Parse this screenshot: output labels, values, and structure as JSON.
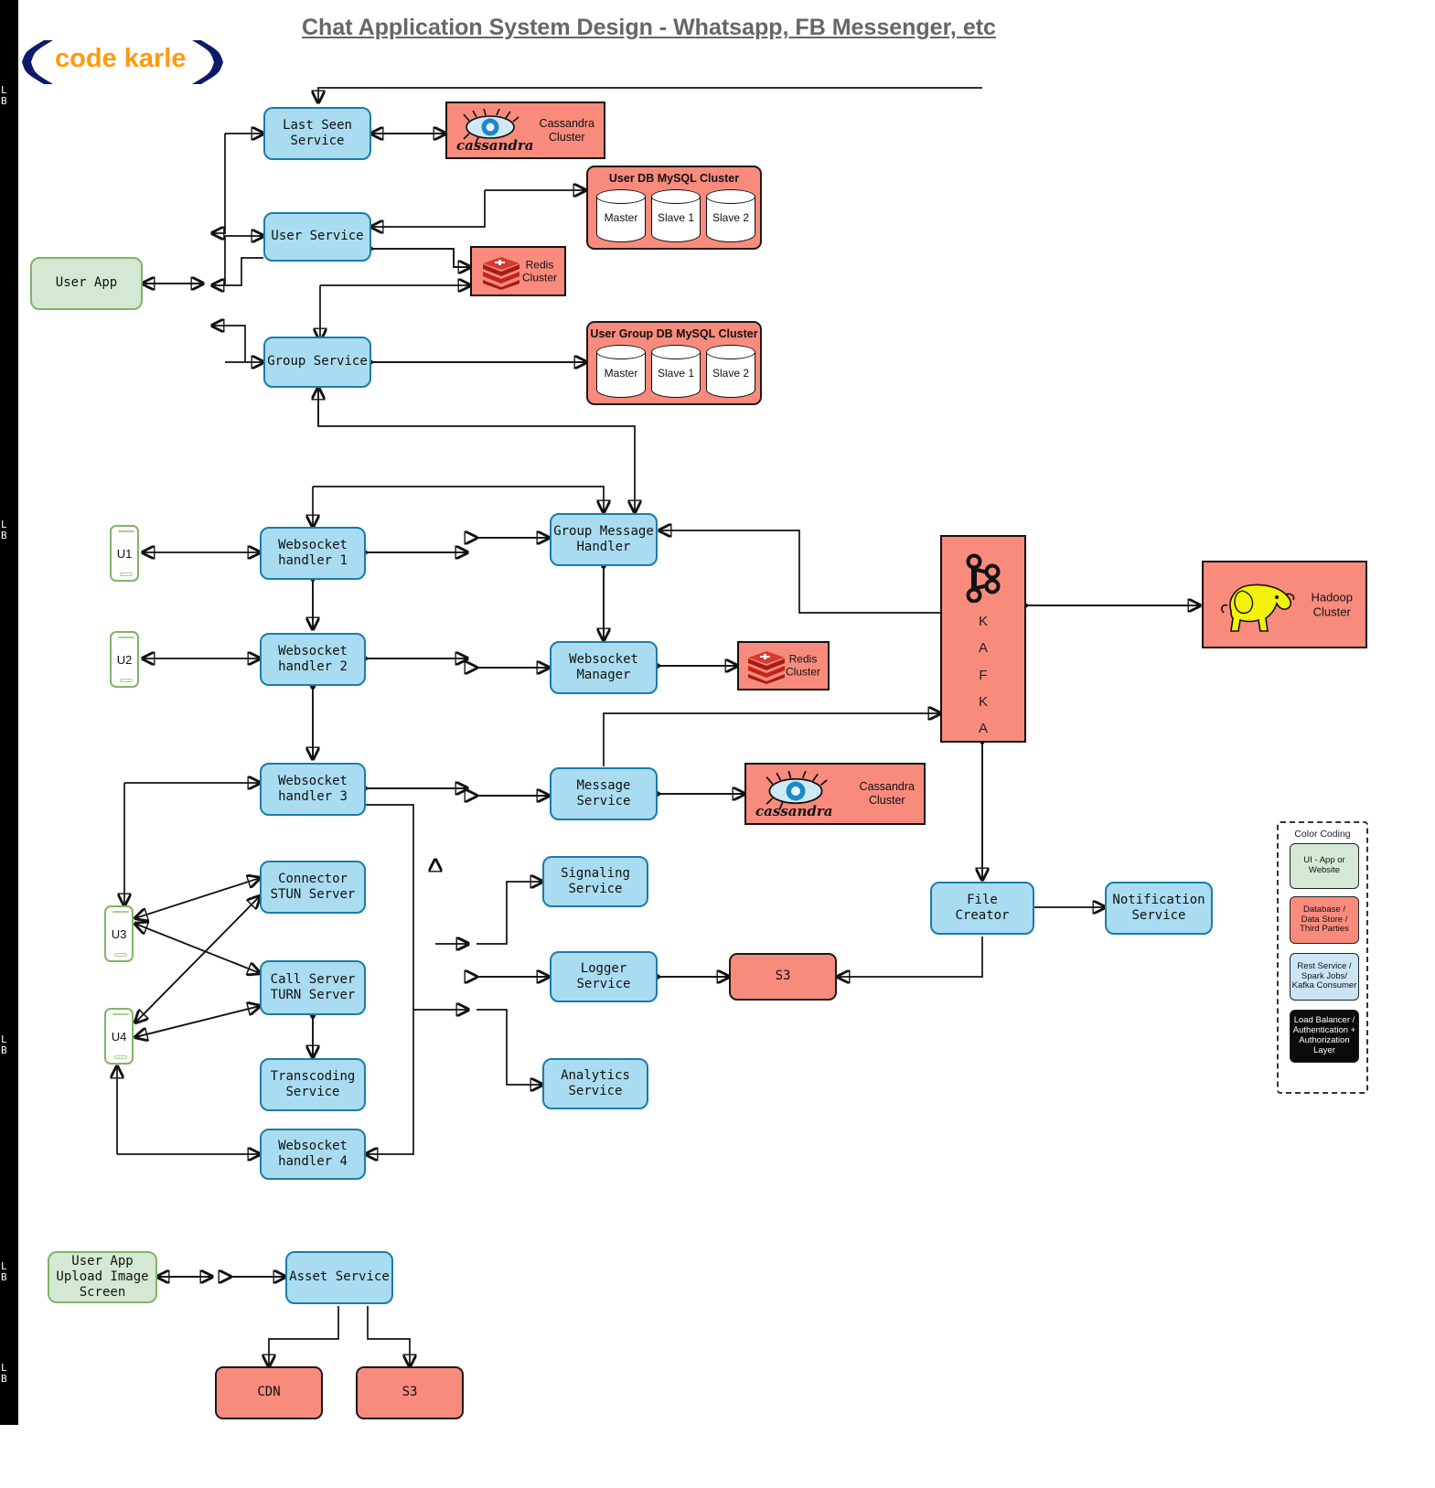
{
  "header": {
    "title": "Chat Application System Design - Whatsapp, FB Messenger, etc",
    "logo_text": "code karle"
  },
  "load_balancers": {
    "label": "L\nB"
  },
  "ui_nodes": [
    {
      "id": "user-app",
      "label": "User App"
    },
    {
      "id": "user-app-upload",
      "label": "User App\nUpload Image\nScreen"
    }
  ],
  "phones": [
    {
      "id": "u1",
      "label": "U1"
    },
    {
      "id": "u2",
      "label": "U2"
    },
    {
      "id": "u3",
      "label": "U3"
    },
    {
      "id": "u4",
      "label": "U4"
    }
  ],
  "services": [
    {
      "id": "last-seen-service",
      "label": "Last Seen\nService"
    },
    {
      "id": "user-service",
      "label": "User Service"
    },
    {
      "id": "group-service",
      "label": "Group Service"
    },
    {
      "id": "websocket-handler-1",
      "label": "Websocket\nhandler 1"
    },
    {
      "id": "websocket-handler-2",
      "label": "Websocket\nhandler 2"
    },
    {
      "id": "websocket-handler-3",
      "label": "Websocket\nhandler 3"
    },
    {
      "id": "websocket-handler-4",
      "label": "Websocket\nhandler 4"
    },
    {
      "id": "group-message-handler",
      "label": "Group Message\nHandler"
    },
    {
      "id": "websocket-manager",
      "label": "Websocket\nManager"
    },
    {
      "id": "message-service",
      "label": "Message\nService"
    },
    {
      "id": "connector-stun-server",
      "label": "Connector\nSTUN Server"
    },
    {
      "id": "call-server-turn-server",
      "label": "Call Server\nTURN Server"
    },
    {
      "id": "transcoding-service",
      "label": "Transcoding\nService"
    },
    {
      "id": "signaling-service",
      "label": "Signaling\nService"
    },
    {
      "id": "logger-service",
      "label": "Logger\nService"
    },
    {
      "id": "analytics-service",
      "label": "Analytics\nService"
    },
    {
      "id": "file-creator",
      "label": "File\nCreator"
    },
    {
      "id": "notification-service",
      "label": "Notification\nService"
    },
    {
      "id": "asset-service",
      "label": "Asset Service"
    }
  ],
  "datastores": [
    {
      "id": "cassandra-cluster-top",
      "label": "Cassandra\nCluster",
      "wordmark": "cassandra"
    },
    {
      "id": "cassandra-cluster-msg",
      "label": "Cassandra\nCluster",
      "wordmark": "cassandra"
    },
    {
      "id": "redis-cluster-user",
      "label": "Redis\nCluster"
    },
    {
      "id": "redis-cluster-ws",
      "label": "Redis\nCluster"
    },
    {
      "id": "s3-logger",
      "label": "S3"
    },
    {
      "id": "s3-asset",
      "label": "S3"
    },
    {
      "id": "cdn-asset",
      "label": "CDN"
    },
    {
      "id": "hadoop-cluster",
      "label": "Hadoop\nCluster"
    },
    {
      "id": "kafka",
      "label": "K\nA\nF\nK\nA"
    }
  ],
  "mysql_clusters": [
    {
      "id": "user-db-mysql-cluster",
      "title": "User DB MySQL Cluster",
      "nodes": [
        "Master",
        "Slave 1",
        "Slave 2"
      ]
    },
    {
      "id": "user-group-db-mysql-cluster",
      "title": "User Group DB MySQL Cluster",
      "nodes": [
        "Master",
        "Slave 1",
        "Slave 2"
      ]
    }
  ],
  "legend": {
    "title": "Color Coding",
    "items": [
      {
        "id": "legend-ui",
        "label": "UI - App or\nWebsite",
        "color": "#D5E8D4"
      },
      {
        "id": "legend-db",
        "label": "Database /\nData Store /\nThird Parties",
        "color": "#F98B7D"
      },
      {
        "id": "legend-svc",
        "label": "Rest Service /\nSpark Jobs/\nKafka Consumer",
        "color": "#CCE5F6"
      },
      {
        "id": "legend-lb",
        "label": "Load Balancer /\nAuthentication +\nAuthorization\nLayer",
        "color": "#0b0b0b"
      }
    ]
  },
  "colors": {
    "service_fill": "#A9DCF0",
    "service_stroke": "#1B7CA8",
    "datastore_fill": "#F98B7D",
    "ui_fill": "#D5E8D4",
    "ui_stroke": "#82B366",
    "lb_fill": "#000000",
    "title_color": "#666666",
    "logo_word_color": "#FF9A0E",
    "logo_bracket_color": "#0D1A6B",
    "hadoop_elephant": "#F2F20A",
    "redis_red": "#C6231C"
  }
}
